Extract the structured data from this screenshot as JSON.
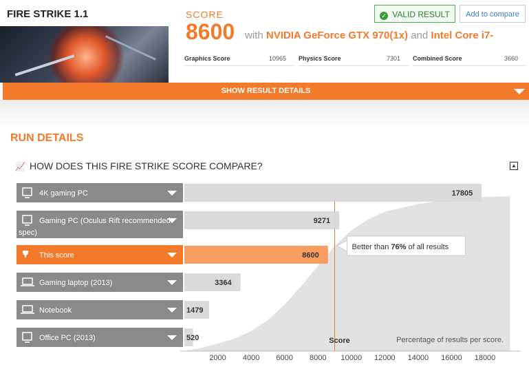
{
  "header": {
    "benchmark_title": "FIRE STRIKE 1.1",
    "score_label": "SCORE",
    "score_value": "8600",
    "with_text": "with",
    "gpu": "NVIDIA GeForce GTX 970(1x)",
    "and_text": "and",
    "cpu": "Intel Core i7-",
    "valid_result": "VALID RESULT",
    "add_to_compare": "Add to compare"
  },
  "subscores": [
    {
      "label": "Graphics Score",
      "value": "10965"
    },
    {
      "label": "Physics Score",
      "value": "7301"
    },
    {
      "label": "Combined Score",
      "value": "3660"
    }
  ],
  "show_result_details": "SHOW RESULT DETAILS",
  "run_details_title": "RUN DETAILS",
  "compare": {
    "title": "HOW DOES THIS FIRE STRIKE SCORE COMPARE?",
    "tooltip_prefix": "Better than",
    "tooltip_percent": "76%",
    "tooltip_suffix": "of all results",
    "score_axis_label": "Score",
    "curve_caption": "Percentage of results per score."
  },
  "colors": {
    "accent": "#f47a2b",
    "label_bg": "#8a8a8a",
    "bar_bg": "#d8d8d8",
    "valid_green": "#4caf50",
    "link_blue": "#3a7bc8"
  },
  "chart_data": {
    "type": "bar",
    "categories": [
      "4K gaming PC",
      "Gaming PC (Oculus Rift recommended spec)",
      "This score",
      "Gaming laptop (2013)",
      "Notebook",
      "Office PC (2013)"
    ],
    "category_icons": [
      "monitor-icon",
      "monitor-icon",
      "trophy-icon",
      "laptop-icon",
      "laptop-icon",
      "monitor-icon"
    ],
    "values": [
      17805,
      9271,
      8600,
      3364,
      1479,
      520
    ],
    "highlight_index": 2,
    "x_ticks": [
      2000,
      4000,
      6000,
      8000,
      10000,
      12000,
      14000,
      16000,
      18000
    ],
    "xlim": [
      0,
      19500
    ],
    "xlabel": "Score",
    "marker_value": 9000,
    "percentile_curve": [
      [
        0,
        0
      ],
      [
        1000,
        2
      ],
      [
        2000,
        5
      ],
      [
        3000,
        8
      ],
      [
        4000,
        13
      ],
      [
        5000,
        20
      ],
      [
        6000,
        30
      ],
      [
        7000,
        42
      ],
      [
        8000,
        55
      ],
      [
        9000,
        68
      ],
      [
        10000,
        78
      ],
      [
        11000,
        85
      ],
      [
        12000,
        90
      ],
      [
        14000,
        95
      ],
      [
        16000,
        98
      ],
      [
        18000,
        99.5
      ],
      [
        19500,
        100
      ]
    ]
  }
}
